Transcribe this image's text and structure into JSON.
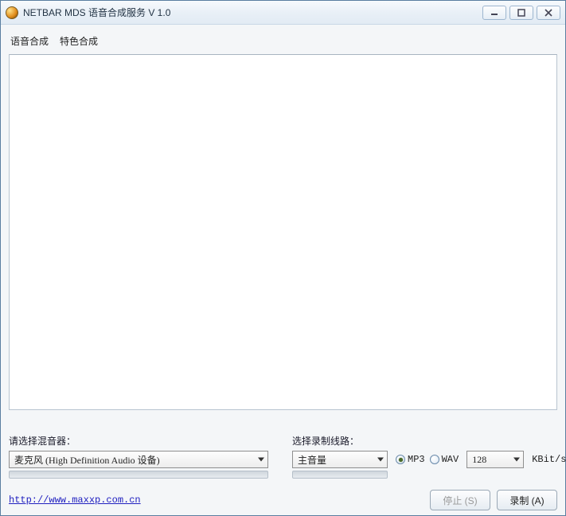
{
  "window": {
    "title": "NETBAR MDS 语音合成服务 V 1.0"
  },
  "tabs": {
    "voice": "语音合成",
    "special": "特色合成"
  },
  "controls": {
    "mixer_label": "请选择混音器：",
    "mixer_value": "麦克风 (High Definition Audio 设备)",
    "line_label": "选择录制线路：",
    "line_value": "主音量",
    "format_mp3": "MP3",
    "format_wav": "WAV",
    "format_selected": "MP3",
    "bitrate_value": "128",
    "bitrate_unit": "KBit/s"
  },
  "footer": {
    "link": "http://www.maxxp.com.cn",
    "stop_label": "停止 (S)",
    "record_label": "录制 (A)"
  }
}
